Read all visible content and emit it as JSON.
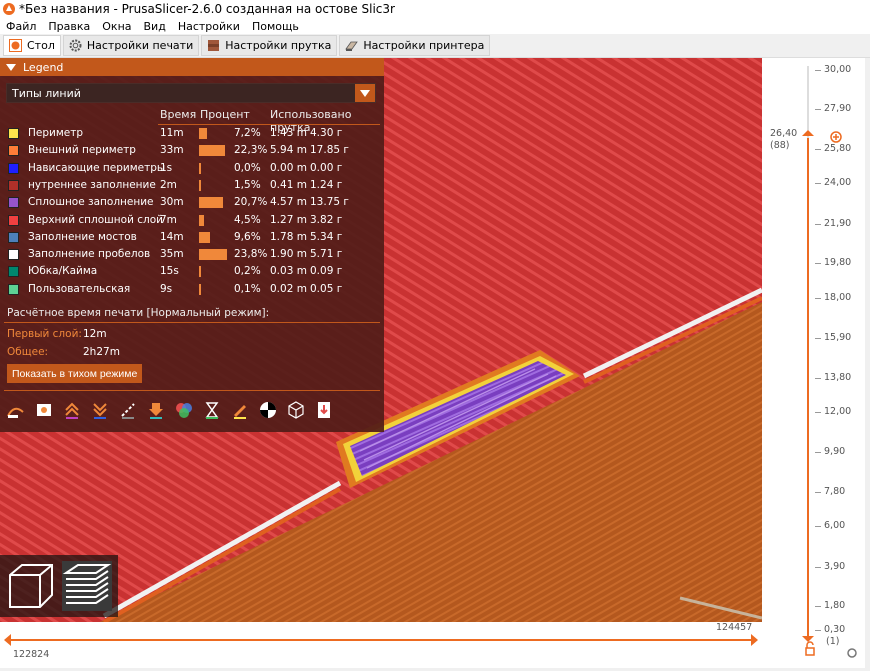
{
  "window": {
    "title": "*Без названия - PrusaSlicer-2.6.0 созданная на остове Slic3r"
  },
  "menu": [
    "Файл",
    "Правка",
    "Окна",
    "Вид",
    "Настройки",
    "Помощь"
  ],
  "tabs": [
    {
      "label": "Стол",
      "icon": "plater-icon"
    },
    {
      "label": "Настройки печати",
      "icon": "gear-icon"
    },
    {
      "label": "Настройки прутка",
      "icon": "spool-icon"
    },
    {
      "label": "Настройки принтера",
      "icon": "printer-icon"
    }
  ],
  "legend": {
    "title": "Legend",
    "view_type": "Типы линий",
    "columns": {
      "time": "Время",
      "percent": "Процент",
      "used": "Использовано прутка"
    },
    "rows": [
      {
        "name": "Периметр",
        "color": "#ffe64d",
        "time": "11m",
        "pct": "7,2%",
        "pct_value": 7.2,
        "m": "1.43 m",
        "g": "4.30 г"
      },
      {
        "name": "Внешний периметр",
        "color": "#ff7d38",
        "time": "33m",
        "pct": "22,3%",
        "pct_value": 22.3,
        "m": "5.94 m",
        "g": "17.85 г"
      },
      {
        "name": "Нависающие периметры",
        "color": "#1f1fff",
        "time": "1s",
        "pct": "0,0%",
        "pct_value": 0.0,
        "m": "0.00 m",
        "g": "0.00 г"
      },
      {
        "name": "нутреннее заполнение",
        "color": "#b03029",
        "time": "2m",
        "pct": "1,5%",
        "pct_value": 1.5,
        "m": "0.41 m",
        "g": "1.24 г"
      },
      {
        "name": "Сплошное заполнение",
        "color": "#9654cc",
        "time": "30m",
        "pct": "20,7%",
        "pct_value": 20.7,
        "m": "4.57 m",
        "g": "13.75 г"
      },
      {
        "name": "Верхний сплошной слой",
        "color": "#f04040",
        "time": "7m",
        "pct": "4,5%",
        "pct_value": 4.5,
        "m": "1.27 m",
        "g": "3.82 г"
      },
      {
        "name": "Заполнение мостов",
        "color": "#4d80ba",
        "time": "14m",
        "pct": "9,6%",
        "pct_value": 9.6,
        "m": "1.78 m",
        "g": "5.34 г"
      },
      {
        "name": "Заполнение пробелов",
        "color": "#ffffff",
        "time": "35m",
        "pct": "23,8%",
        "pct_value": 23.8,
        "m": "1.90 m",
        "g": "5.71 г"
      },
      {
        "name": "Юбка/Кайма",
        "color": "#00876e",
        "time": "15s",
        "pct": "0,2%",
        "pct_value": 0.2,
        "m": "0.03 m",
        "g": "0.09 г"
      },
      {
        "name": "Пользовательская",
        "color": "#5ed194",
        "time": "9s",
        "pct": "0,1%",
        "pct_value": 0.1,
        "m": "0.02 m",
        "g": "0.05 г"
      }
    ],
    "estimate_title": "Расчётное время печати [Нормальный режим]:",
    "first_layer_label": "Первый слой:",
    "first_layer_value": "12m",
    "total_label": "Общее:",
    "total_value": "2h27m",
    "silent_button": "Показать в тихом режиме"
  },
  "vslider": {
    "ticks": [
      "30,00",
      "27,90",
      "25,80",
      "24,00",
      "21,90",
      "19,80",
      "18,00",
      "15,90",
      "13,80",
      "12,00",
      "9,90",
      "7,80",
      "6,00",
      "3,90",
      "1,80",
      "0,30"
    ],
    "top_value": "26,40",
    "top_layer": "(88)",
    "bottom_layer": "(1)"
  },
  "hslider": {
    "left_value": "122824",
    "right_value": "124457"
  },
  "colors": {
    "accent": "#ed6b21",
    "legend_bg": "#501c18",
    "model_bg": "#c43030"
  }
}
